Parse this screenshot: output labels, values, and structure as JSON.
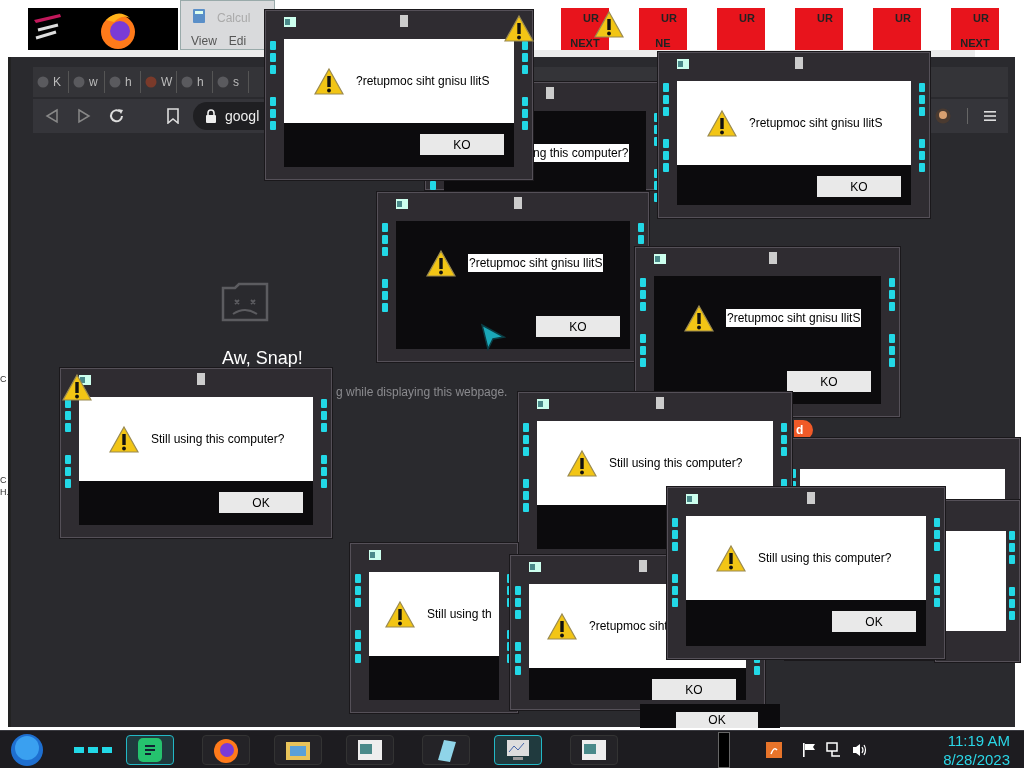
{
  "top_strip": {
    "calculator": {
      "title": "Calcul",
      "menu": [
        "View",
        "Edi"
      ]
    },
    "tiles": [
      {
        "top": "UR",
        "bottom": "NEXT"
      },
      {
        "top": "UR",
        "bottom": "NE"
      },
      {
        "top": "UR"
      },
      {
        "top": "UR"
      },
      {
        "top": "UR"
      },
      {
        "top": "UR",
        "bottom": "NEXT"
      }
    ]
  },
  "browser": {
    "tabs": [
      "K",
      "w",
      "h",
      "W",
      "h",
      "s"
    ],
    "address": "googl",
    "error_title": "Aw, Snap!",
    "error_message": "g while displaying this webpage.",
    "reload_button": "d"
  },
  "edge_fragments": [
    "C",
    "C",
    "H."
  ],
  "dialogs": [
    {
      "kind": "dark",
      "message": "ng this computer?"
    },
    {
      "kind": "light",
      "message": "?retupmoc siht gnisu llitS",
      "button": "KO"
    },
    {
      "kind": "light",
      "message": "?retupmoc siht gnisu llitS",
      "button": "KO"
    },
    {
      "kind": "dark",
      "message": "?retupmoc siht gnisu llitS",
      "button": "KO"
    },
    {
      "kind": "dark",
      "message": "?retupmoc siht gnisu llitS",
      "button": "KO"
    },
    {
      "kind": "light",
      "message": "Still using this computer?",
      "button": "OK"
    },
    {
      "kind": "light",
      "message": "Still using this computer?"
    },
    {
      "kind": "light",
      "message": "Still using th"
    },
    {
      "kind": "light",
      "message": "?retupmoc siht",
      "button": "KO"
    },
    {
      "kind": "light",
      "message": "Still using this computer?",
      "button": "OK"
    },
    {
      "kind": "button_only",
      "button": "OK"
    }
  ],
  "taskbar": {
    "time": "11:19 AM",
    "date": "8/28/2023"
  }
}
